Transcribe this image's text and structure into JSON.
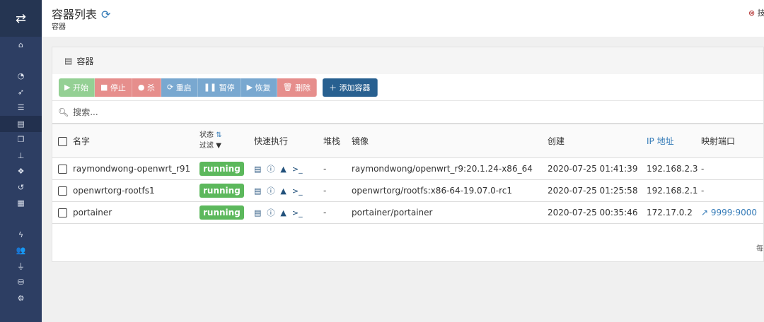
{
  "sidebar": {
    "items": [
      {
        "icon": "home-icon",
        "glyph": "⌂"
      },
      {
        "icon": "dashboard-icon",
        "glyph": "◔"
      },
      {
        "icon": "rocket-icon",
        "glyph": "➶"
      },
      {
        "icon": "list-icon",
        "glyph": "☰"
      },
      {
        "icon": "server-icon",
        "glyph": "▤",
        "active": true
      },
      {
        "icon": "clone-icon",
        "glyph": "❐"
      },
      {
        "icon": "sitemap-icon",
        "glyph": "⊥"
      },
      {
        "icon": "cubes-icon",
        "glyph": "❖"
      },
      {
        "icon": "history-icon",
        "glyph": "↺"
      },
      {
        "icon": "grid-icon",
        "glyph": "▦"
      },
      {
        "icon": "bolt-icon",
        "glyph": "ϟ"
      },
      {
        "icon": "users-icon",
        "glyph": "👥"
      },
      {
        "icon": "plug-icon",
        "glyph": "⏚"
      },
      {
        "icon": "database-icon",
        "glyph": "⛁"
      },
      {
        "icon": "cogs-icon",
        "glyph": "⚙"
      }
    ]
  },
  "header": {
    "title": "容器列表",
    "subtitle": "容器",
    "help": "技"
  },
  "panel": {
    "title": "容器"
  },
  "actions": {
    "start": "开始",
    "stop": "停止",
    "kill": "杀",
    "restart": "重启",
    "pause": "暂停",
    "resume": "恢复",
    "remove": "删除",
    "add": "添加容器"
  },
  "search": {
    "placeholder": "搜索..."
  },
  "columns": {
    "name": "名字",
    "state": "状态",
    "filter": "过滤",
    "quick": "快速执行",
    "stack": "堆栈",
    "image": "镜像",
    "created": "创建",
    "ip": "IP 地址",
    "ports": "映射端口"
  },
  "rows": [
    {
      "name": "raymondwong-openwrt_r91",
      "state": "running",
      "stack": "-",
      "image": "raymondwong/openwrt_r9:20.1.24-x86_64",
      "created": "2020-07-25 01:41:39",
      "ip": "192.168.2.3",
      "ports": "-"
    },
    {
      "name": "openwrtorg-rootfs1",
      "state": "running",
      "stack": "-",
      "image": "openwrtorg/rootfs:x86-64-19.07.0-rc1",
      "created": "2020-07-25 01:25:58",
      "ip": "192.168.2.1",
      "ports": "-"
    },
    {
      "name": "portainer",
      "state": "running",
      "stack": "-",
      "image": "portainer/portainer",
      "created": "2020-07-25 00:35:46",
      "ip": "172.17.0.2",
      "ports": "9999:9000"
    }
  ],
  "footer": {
    "per_page": "每"
  }
}
